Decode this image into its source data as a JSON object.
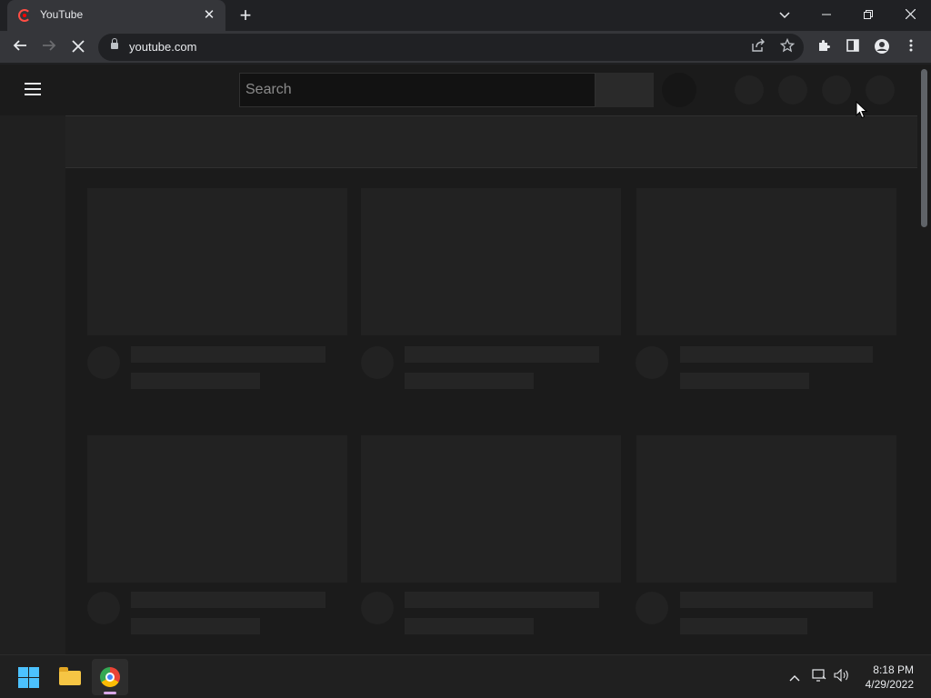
{
  "browser": {
    "tab": {
      "title": "YouTube",
      "favicon": "youtube-loading-icon"
    },
    "new_tab_icon": "plus-icon",
    "window_controls": [
      "chevron-down-icon",
      "minimize-icon",
      "restore-icon",
      "close-icon"
    ],
    "address_bar": {
      "url": "youtube.com",
      "security_icon": "lock-icon"
    },
    "toolbar_icons": [
      "share-icon",
      "star-icon",
      "puzzle-icon",
      "side-panel-icon",
      "profile-icon",
      "kebab-menu-icon"
    ]
  },
  "youtube": {
    "search": {
      "placeholder": "Search"
    },
    "state": "loading-skeleton"
  },
  "taskbar": {
    "apps": [
      "windows-start-icon",
      "file-explorer-icon",
      "chrome-icon"
    ],
    "tray_icons": [
      "chevron-up-icon",
      "network-icon",
      "volume-icon"
    ],
    "clock": {
      "time": "8:18 PM",
      "date": "4/29/2022"
    }
  },
  "colors": {
    "browser_frame": "#202124",
    "toolbar": "#35363a",
    "page_bg": "#1b1b1b",
    "skeleton": "#222222",
    "youtube_red": "#ff0000"
  }
}
